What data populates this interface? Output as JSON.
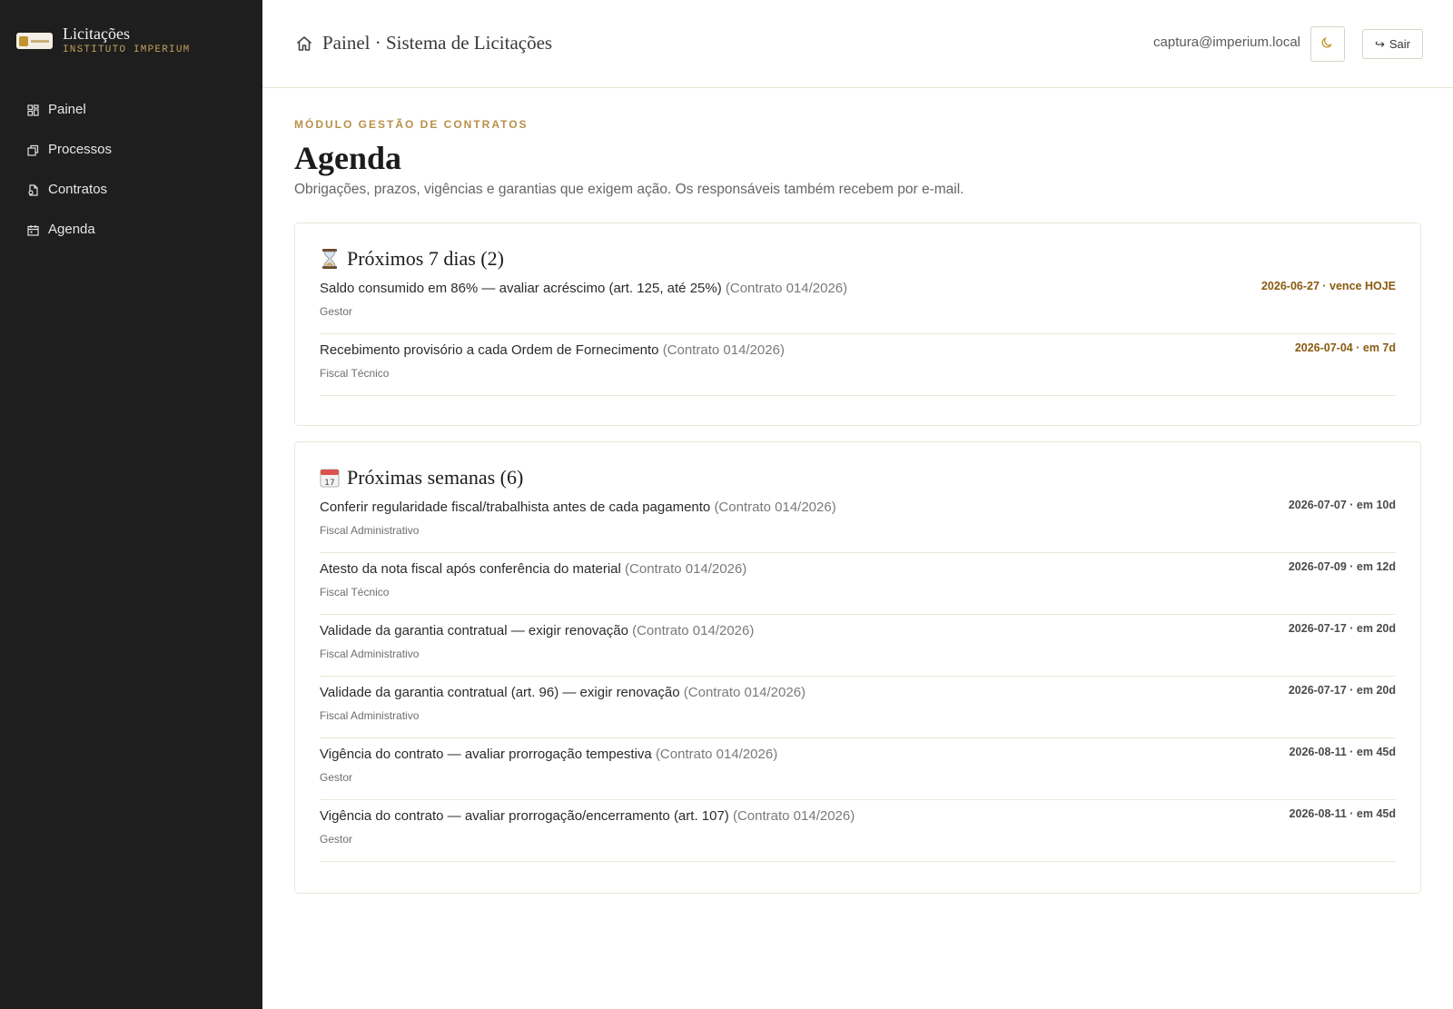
{
  "brand": {
    "title": "Licitações",
    "subtitle": "INSTITUTO IMPERIUM"
  },
  "sidebar": {
    "items": [
      {
        "label": "Painel",
        "icon": "dashboard-icon"
      },
      {
        "label": "Processos",
        "icon": "processes-icon"
      },
      {
        "label": "Contratos",
        "icon": "contract-icon"
      },
      {
        "label": "Agenda",
        "icon": "calendar-icon"
      }
    ]
  },
  "header": {
    "title": "Painel · Sistema de Licitações",
    "user": "captura@imperium.local",
    "theme_icon": "moon-icon",
    "logout_label": "Sair"
  },
  "main": {
    "eyebrow": "MÓDULO GESTÃO DE CONTRATOS",
    "title": "Agenda",
    "description": "Obrigações, prazos, vigências e garantias que exigem ação. Os responsáveis também recebem por e-mail.",
    "sections": [
      {
        "title": "Próximos 7 dias (2)",
        "icon": "hourglass-icon",
        "items": [
          {
            "text": "Saldo consumido em 86% — avaliar acréscimo (art. 125, até 25%)",
            "ref": "(Contrato 014/2026)",
            "role": "Gestor",
            "date": "2026-06-27 · vence HOJE"
          },
          {
            "text": "Recebimento provisório a cada Ordem de Fornecimento",
            "ref": "(Contrato 014/2026)",
            "role": "Fiscal Técnico",
            "date": "2026-07-04 · em 7d"
          }
        ]
      },
      {
        "title": "Próximas semanas (6)",
        "icon": "calendar-date-icon",
        "items": [
          {
            "text": "Conferir regularidade fiscal/trabalhista antes de cada pagamento",
            "ref": "(Contrato 014/2026)",
            "role": "Fiscal Administrativo",
            "date": "2026-07-07 · em 10d"
          },
          {
            "text": "Atesto da nota fiscal após conferência do material",
            "ref": "(Contrato 014/2026)",
            "role": "Fiscal Técnico",
            "date": "2026-07-09 · em 12d"
          },
          {
            "text": "Validade da garantia contratual — exigir renovação",
            "ref": "(Contrato 014/2026)",
            "role": "Fiscal Administrativo",
            "date": "2026-07-17 · em 20d"
          },
          {
            "text": "Validade da garantia contratual (art. 96) — exigir renovação",
            "ref": "(Contrato 014/2026)",
            "role": "Fiscal Administrativo",
            "date": "2026-07-17 · em 20d"
          },
          {
            "text": "Vigência do contrato — avaliar prorrogação tempestiva",
            "ref": "(Contrato 014/2026)",
            "role": "Gestor",
            "date": "2026-08-11 · em 45d"
          },
          {
            "text": "Vigência do contrato — avaliar prorrogação/encerramento (art. 107)",
            "ref": "(Contrato 014/2026)",
            "role": "Gestor",
            "date": "2026-08-11 · em 45d"
          }
        ]
      }
    ]
  },
  "colors": {
    "sidebar_bg": "#1e1e1e",
    "accent_gold": "#b8904a",
    "urgent_date": "#8a5a10"
  }
}
